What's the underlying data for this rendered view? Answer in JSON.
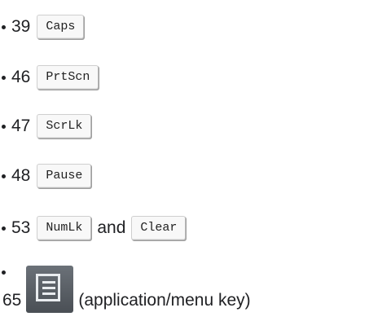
{
  "items": [
    {
      "number": "39",
      "keys": [
        "Caps"
      ]
    },
    {
      "number": "46",
      "keys": [
        "PrtScn"
      ]
    },
    {
      "number": "47",
      "keys": [
        "ScrLk"
      ]
    },
    {
      "number": "48",
      "keys": [
        "Pause"
      ]
    },
    {
      "number": "53",
      "keys": [
        "NumLk",
        "Clear"
      ],
      "connector": "and"
    }
  ],
  "last_item": {
    "number": "65",
    "icon": "menu-key-icon",
    "description": "(application/menu key)"
  }
}
